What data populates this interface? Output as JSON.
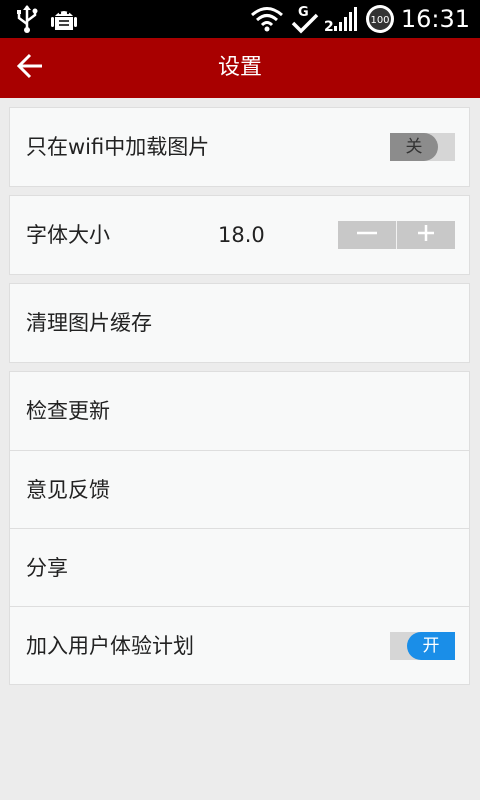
{
  "status_bar": {
    "time": "16:31",
    "battery_level": "100",
    "network_label": "G",
    "icons": [
      "usb-icon",
      "android-debug-icon",
      "wifi-icon",
      "sync-check-icon",
      "signal-icon",
      "battery-icon"
    ]
  },
  "header": {
    "title": "设置",
    "back_icon": "back-arrow-icon",
    "background_color": "#a80000"
  },
  "settings": {
    "wifi_images": {
      "label": "只在wifi中加载图片",
      "toggle_text": "关",
      "enabled": false
    },
    "font_size": {
      "label": "字体大小",
      "value": "18.0",
      "minus_icon": "minus-icon",
      "plus_icon": "plus-icon"
    },
    "clear_cache": {
      "label": "清理图片缓存"
    },
    "check_update": {
      "label": "检查更新"
    },
    "feedback": {
      "label": "意见反馈"
    },
    "share": {
      "label": "分享"
    },
    "user_experience": {
      "label": "加入用户体验计划",
      "toggle_text": "开",
      "enabled": true
    }
  },
  "colors": {
    "toggle_on": "#1a8ee8",
    "toggle_off_knob": "#8c8c8c",
    "page_background": "#ececec"
  }
}
